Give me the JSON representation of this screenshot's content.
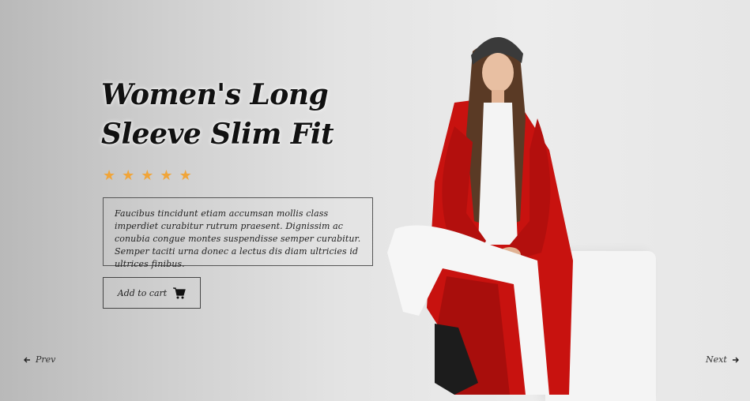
{
  "product": {
    "title_line1": "Women's Long",
    "title_line2": "Sleeve Slim Fit",
    "rating": 5,
    "rating_max": 5,
    "description": "Faucibus tincidunt etiam accumsan mollis class imperdiet curabitur rutrum praesent. Dignissim ac conubia congue montes suspendisse semper curabitur. Semper taciti urna donec a lectus dis diam ultricies id ultrices finibus.",
    "add_to_cart_label": "Add to cart"
  },
  "navigation": {
    "prev_label": "Prev",
    "next_label": "Next"
  },
  "colors": {
    "star": "#f0a53a",
    "coat": "#c8120f",
    "text": "#111111"
  },
  "icons": {
    "cart": "shopping-cart-icon",
    "prev": "arrow-left-icon",
    "next": "arrow-right-icon",
    "star": "star-icon"
  }
}
